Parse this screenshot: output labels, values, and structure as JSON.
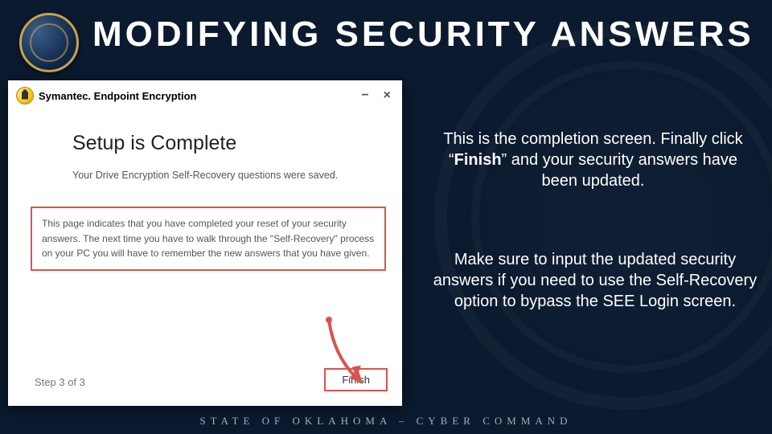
{
  "slide": {
    "title": "MODIFYING SECURITY ANSWERS",
    "footer": "STATE OF OKLAHOMA – CYBER COMMAND"
  },
  "app_window": {
    "title": "Symantec. Endpoint Encryption",
    "heading": "Setup is Complete",
    "saved_line": "Your Drive Encryption Self-Recovery questions were saved.",
    "info_box": "This page indicates that you have completed your reset of your security answers. The next time you have to walk through the \"Self-Recovery\" process on your PC you will have to remember the new answers that you have given.",
    "step": "Step 3 of 3",
    "finish_label": "Finish"
  },
  "explain": {
    "p1_a": "This is the completion screen. Finally click “",
    "p1_bold": "Finish",
    "p1_b": "” and your security answers have been updated.",
    "p2": "Make sure to input the updated security answers if you need to use the Self-Recovery option to bypass the SEE Login screen."
  }
}
